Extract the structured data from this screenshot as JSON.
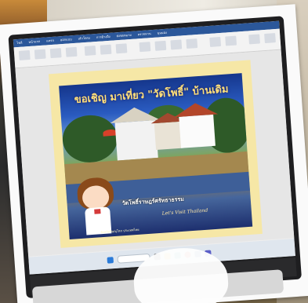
{
  "ribbon": {
    "tabs": [
      "ไฟล์",
      "หน้าแรก",
      "แทรก",
      "ออกแบบ",
      "เค้าโครง",
      "การอ้างอิง",
      "ส่งจดหมาย",
      "ตรวจทาน",
      "มุมมอง"
    ]
  },
  "poster": {
    "title": "ขอเชิญ มาเที่ยว \"วัดโพธิ์\" บ้านเดิม",
    "subtitle": "วัดโพธิ์ราษฎร์ศรัทธาธรรม",
    "tagline": "Let's Visit Thailand",
    "footer": "จังหวัดพิษณุโลก ประเทศไทย"
  },
  "taskbar": {
    "icons": [
      "windows-start-icon",
      "search-box",
      "task-view-icon",
      "file-explorer-icon",
      "edge-icon",
      "chrome-icon",
      "word-icon",
      "store-icon"
    ]
  }
}
